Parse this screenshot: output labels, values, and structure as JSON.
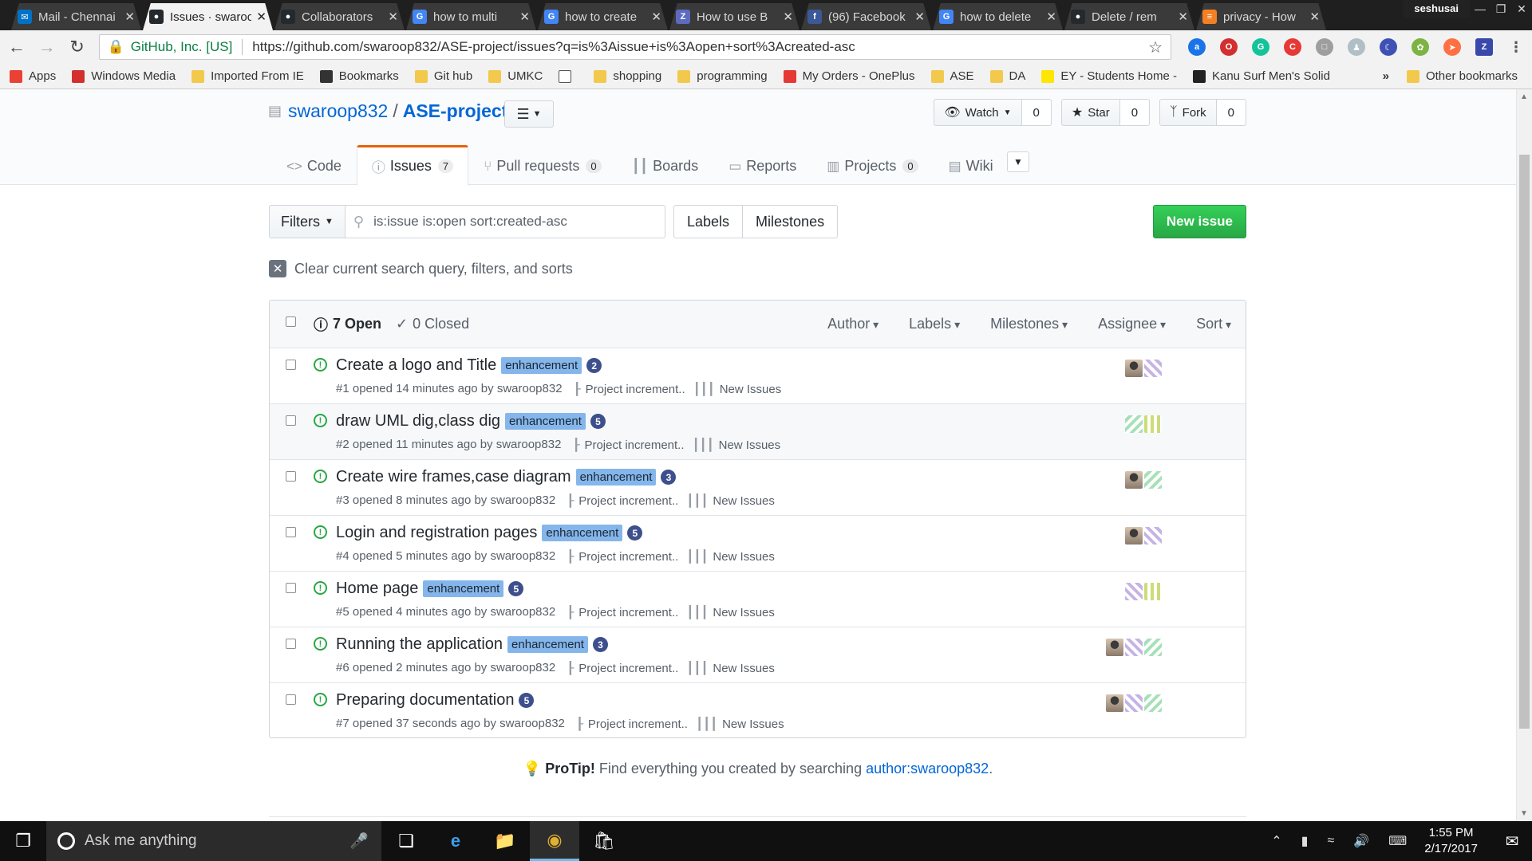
{
  "browser": {
    "tabs": [
      {
        "title": "Mail - Chennai",
        "fav": "mail-icon",
        "color": "#0072c6",
        "glyph": "✉"
      },
      {
        "title": "Issues · swaroop",
        "fav": "github-icon",
        "color": "#24292e",
        "glyph": "●",
        "active": true
      },
      {
        "title": "Collaborators",
        "fav": "github-icon",
        "color": "#24292e",
        "glyph": "●"
      },
      {
        "title": "how to multi",
        "fav": "google-icon",
        "color": "#4285f4",
        "glyph": "G"
      },
      {
        "title": "how to create",
        "fav": "google-icon",
        "color": "#4285f4",
        "glyph": "G"
      },
      {
        "title": "How to use B",
        "fav": "zapier-icon",
        "color": "#5c6bc0",
        "glyph": "Z"
      },
      {
        "title": "(96) Facebook",
        "fav": "facebook-icon",
        "color": "#3b5998",
        "glyph": "f"
      },
      {
        "title": "how to delete",
        "fav": "google-icon",
        "color": "#4285f4",
        "glyph": "G"
      },
      {
        "title": "Delete / rem",
        "fav": "github-icon",
        "color": "#24292e",
        "glyph": "●"
      },
      {
        "title": "privacy - How",
        "fav": "stack-icon",
        "color": "#f48024",
        "glyph": "≡"
      }
    ],
    "user": "seshusai",
    "secure_label": "GitHub, Inc. [US]",
    "url": "https://github.com/swaroop832/ASE-project/issues?q=is%3Aissue+is%3Aopen+sort%3Acreated-asc",
    "bookmarks": [
      {
        "label": "Apps",
        "type": "apps-icon"
      },
      {
        "label": "Windows Media",
        "type": "media-icon"
      },
      {
        "label": "Imported From IE",
        "type": "folder"
      },
      {
        "label": "Bookmarks",
        "type": "star-icon"
      },
      {
        "label": "Git hub",
        "type": "folder"
      },
      {
        "label": "UMKC",
        "type": "folder"
      },
      {
        "label": "",
        "type": "page-icon"
      },
      {
        "label": "shopping",
        "type": "folder"
      },
      {
        "label": "programming",
        "type": "folder"
      },
      {
        "label": "My Orders - OnePlus",
        "type": "oneplus-icon"
      },
      {
        "label": "ASE",
        "type": "folder"
      },
      {
        "label": "DA",
        "type": "folder"
      },
      {
        "label": "EY - Students Home -",
        "type": "ey-icon"
      },
      {
        "label": "Kanu Surf Men's Solid",
        "type": "amazon-icon"
      }
    ],
    "bookmarks_more": "»",
    "other_bookmarks": "Other bookmarks"
  },
  "repo": {
    "owner": "swaroop832",
    "separator": "/",
    "name": "ASE-project",
    "watch_label": "Watch",
    "watch_count": "0",
    "star_label": "Star",
    "star_count": "0",
    "fork_label": "Fork",
    "fork_count": "0",
    "tabs": [
      {
        "label": "Code",
        "icon": "code-icon",
        "glyph": "<>"
      },
      {
        "label": "Issues",
        "icon": "issue-icon",
        "glyph": "ⓘ",
        "count": "7",
        "selected": true
      },
      {
        "label": "Pull requests",
        "icon": "pr-icon",
        "glyph": "⑂",
        "count": "0"
      },
      {
        "label": "Boards",
        "icon": "boards-icon",
        "glyph": "┃┃"
      },
      {
        "label": "Reports",
        "icon": "reports-icon",
        "glyph": "▭"
      },
      {
        "label": "Projects",
        "icon": "projects-icon",
        "glyph": "▥",
        "count": "0"
      },
      {
        "label": "Wiki",
        "icon": "wiki-icon",
        "glyph": "▤"
      }
    ]
  },
  "subnav": {
    "filters_label": "Filters",
    "search_value": "is:issue is:open sort:created-asc",
    "labels_label": "Labels",
    "milestones_label": "Milestones",
    "new_issue_label": "New issue"
  },
  "clear_query": "Clear current search query, filters, and sorts",
  "issues_header": {
    "open": "7 Open",
    "closed": "0 Closed",
    "menus": [
      "Author",
      "Labels",
      "Milestones",
      "Assignee",
      "Sort"
    ]
  },
  "issues": [
    {
      "title": "Create a logo and Title",
      "label": "enhancement",
      "comments": "2",
      "meta": "#1 opened 14 minutes ago by swaroop832",
      "milestone": "Project increment..",
      "project": "New Issues",
      "avatars": [
        "av-a",
        "av-b"
      ]
    },
    {
      "title": "draw UML dig,class dig",
      "label": "enhancement",
      "comments": "5",
      "meta": "#2 opened 11 minutes ago by swaroop832",
      "milestone": "Project increment..",
      "project": "New Issues",
      "avatars": [
        "av-c",
        "av-d"
      ],
      "hover": true
    },
    {
      "title": "Create wire frames,case diagram",
      "label": "enhancement",
      "comments": "3",
      "meta": "#3 opened 8 minutes ago by swaroop832",
      "milestone": "Project increment..",
      "project": "New Issues",
      "avatars": [
        "av-a",
        "av-c"
      ]
    },
    {
      "title": "Login and registration pages",
      "label": "enhancement",
      "comments": "5",
      "meta": "#4 opened 5 minutes ago by swaroop832",
      "milestone": "Project increment..",
      "project": "New Issues",
      "avatars": [
        "av-a",
        "av-b"
      ]
    },
    {
      "title": "Home page",
      "label": "enhancement",
      "comments": "5",
      "meta": "#5 opened 4 minutes ago by swaroop832",
      "milestone": "Project increment..",
      "project": "New Issues",
      "avatars": [
        "av-b",
        "av-d"
      ]
    },
    {
      "title": "Running the application",
      "label": "enhancement",
      "comments": "3",
      "meta": "#6 opened 2 minutes ago by swaroop832",
      "milestone": "Project increment..",
      "project": "New Issues",
      "avatars": [
        "av-a",
        "av-b",
        "av-c"
      ]
    },
    {
      "title": "Preparing documentation",
      "label": "",
      "comments": "5",
      "meta": "#7 opened 37 seconds ago by swaroop832",
      "milestone": "Project increment..",
      "project": "New Issues",
      "avatars": [
        "av-a",
        "av-b",
        "av-c"
      ]
    }
  ],
  "protip": {
    "strong": "ProTip!",
    "text": " Find everything you created by searching ",
    "link": "author:swaroop832",
    "end": "."
  },
  "taskbar": {
    "search_placeholder": "Ask me anything",
    "time": "1:55 PM",
    "date": "2/17/2017"
  },
  "colors": {
    "accent": "#0366d6",
    "open_green": "#28a745",
    "label_blue": "#84b6eb",
    "tab_indicator": "#e36209"
  }
}
